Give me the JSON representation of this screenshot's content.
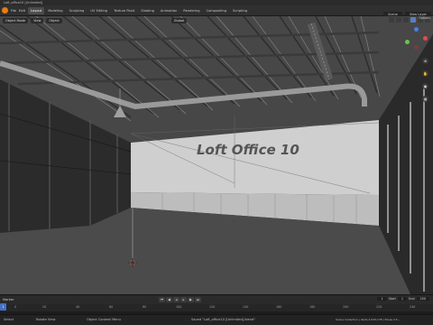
{
  "window": {
    "title": "Loft_office10 [Unlimited]"
  },
  "menu": [
    "File",
    "Edit",
    "Render",
    "Window",
    "Help"
  ],
  "workspaces": [
    {
      "label": "Layout",
      "active": true
    },
    {
      "label": "Modeling"
    },
    {
      "label": "Sculpting"
    },
    {
      "label": "UV Editing"
    },
    {
      "label": "Texture Paint"
    },
    {
      "label": "Shading"
    },
    {
      "label": "Animation"
    },
    {
      "label": "Rendering"
    },
    {
      "label": "Compositing"
    },
    {
      "label": "Scripting"
    }
  ],
  "scene": {
    "scene_name": "Scene",
    "view_layer": "View Layer"
  },
  "viewport_header": {
    "mode": "Object Mode",
    "view": "View",
    "object": "Object",
    "transform": "Global",
    "options": "Options"
  },
  "viewport": {
    "wall_text": "Loft Office 10",
    "shading_mode": "solid"
  },
  "gizmo": {
    "axes": [
      {
        "name": "x",
        "color": "#e24a4a"
      },
      {
        "name": "y",
        "color": "#6bc44b"
      },
      {
        "name": "z",
        "color": "#4a7ee2"
      }
    ]
  },
  "nav_icons": [
    "zoom-icon",
    "hand-icon",
    "camera-icon",
    "grid-icon"
  ],
  "timeline": {
    "label": "Marker",
    "current_frame": "1",
    "start_label": "Start",
    "start": "1",
    "end_label": "End",
    "end": "250",
    "ticks": [
      "0",
      "20",
      "40",
      "60",
      "80",
      "100",
      "120",
      "140",
      "160",
      "180",
      "200",
      "220",
      "240"
    ]
  },
  "status": {
    "left": "Select",
    "mid_left": "Rotate View",
    "mid": "Object Context Menu",
    "center": "Saved \"Loft_office10 [Unlimited].blend\"",
    "right": "Scene Collection | Verts 2,543,178 | Faces 2,5..."
  },
  "colors": {
    "accent": "#e87d0d",
    "active_blue": "#4672c4",
    "viewport_bg": "#3d3d3d"
  }
}
